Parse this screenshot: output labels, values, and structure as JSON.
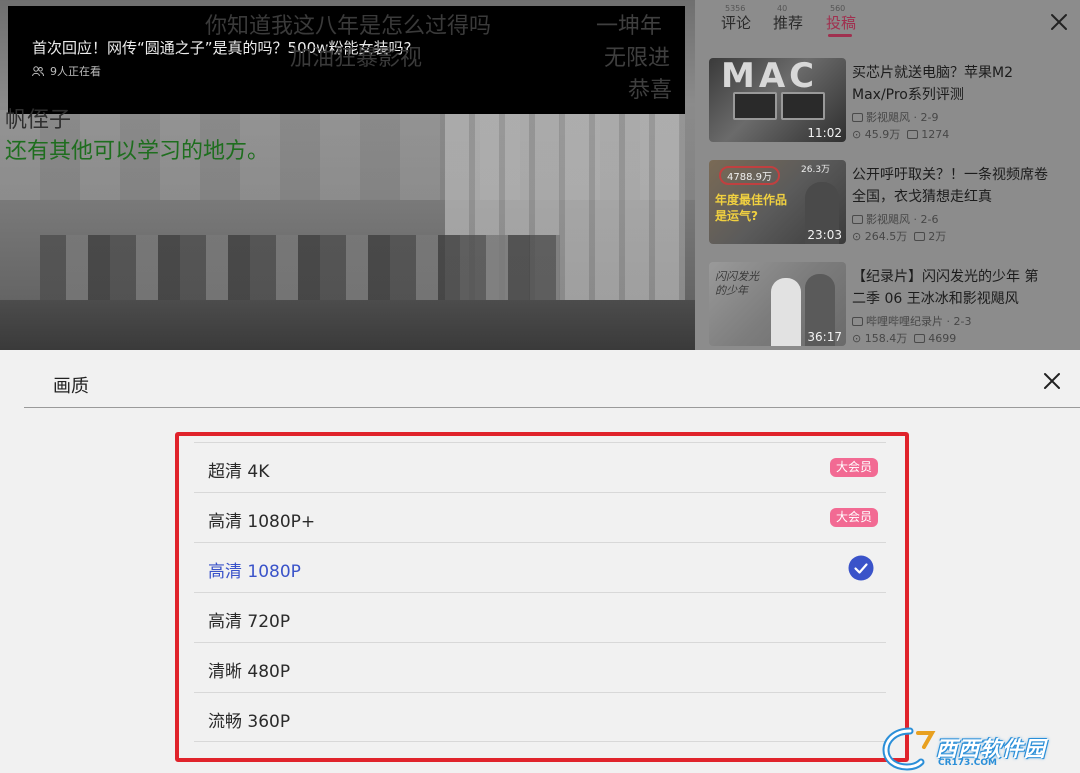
{
  "video": {
    "title": "首次回应！网传“圆通之子”是真的吗？500w粉能女装吗?",
    "viewers": "9人正在看",
    "danmaku": [
      "你知道我这八年是怎么过得吗",
      "加油狂暴影视",
      "一坤年",
      "无限进",
      "恭喜",
      "帆侄子",
      "还有其他可以学习的地方。"
    ]
  },
  "sidebar": {
    "tabs": [
      {
        "label": "评论",
        "count": "5356"
      },
      {
        "label": "推荐",
        "count": "40"
      },
      {
        "label": "投稿",
        "count": "560"
      }
    ],
    "videos": [
      {
        "title": "买芯片就送电脑？苹果M2 Max/Pro系列评测",
        "uploader": "影视飓风 · 2-9",
        "views": "45.9万",
        "danmaku": "1274",
        "duration": "11:02",
        "thumb_text": "MAC"
      },
      {
        "title": "公开呼吁取关？！一条视频席卷全国，衣戈猜想走红真",
        "uploader": "影视飓风 · 2-6",
        "views": "264.5万",
        "danmaku": "2万",
        "duration": "23:03",
        "thumb_text": "年度最佳作品 是运气?",
        "thumb_badge1": "4788.9万",
        "thumb_badge2": "26.3万"
      },
      {
        "title": "【纪录片】闪闪发光的少年 第二季 06 王冰冰和影视飓风",
        "uploader": "哔哩哔哩纪录片 · 2-3",
        "views": "158.4万",
        "danmaku": "4699",
        "duration": "36:17",
        "thumb_text": "闪闪发光的少年"
      }
    ]
  },
  "quality_panel": {
    "title": "画质",
    "options": [
      {
        "label": "超清 4K",
        "badge": "大会员",
        "selected": false
      },
      {
        "label": "高清 1080P+",
        "badge": "大会员",
        "selected": false
      },
      {
        "label": "高清 1080P",
        "badge": "",
        "selected": true
      },
      {
        "label": "高清 720P",
        "badge": "",
        "selected": false
      },
      {
        "label": "清晰 480P",
        "badge": "",
        "selected": false
      },
      {
        "label": "流畅 360P",
        "badge": "",
        "selected": false
      }
    ]
  },
  "watermark": {
    "text": "西西软件园",
    "url": "CR173.COM"
  },
  "colors": {
    "accent_selected": "#3a53c9",
    "vip_badge": "#f26a93",
    "highlight_border": "#e0232b",
    "tab_active": "#a0304f"
  }
}
